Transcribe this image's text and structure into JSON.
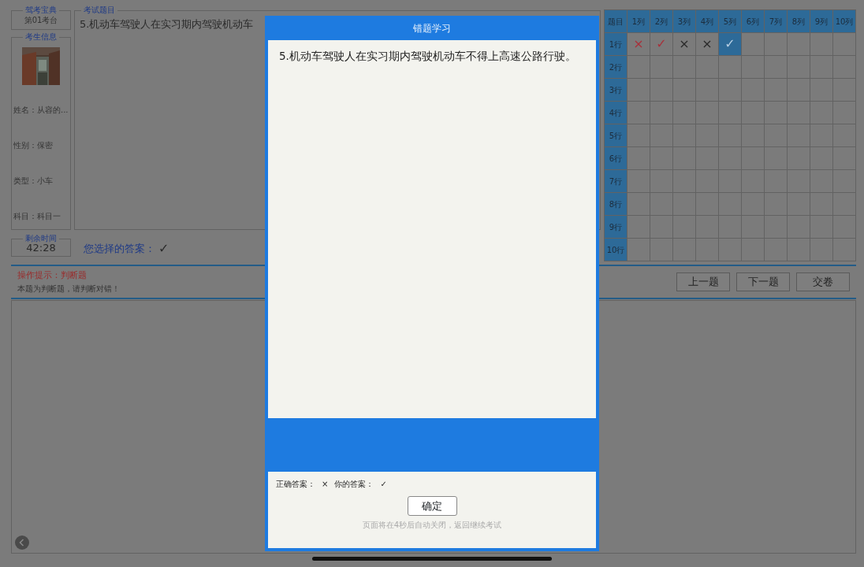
{
  "sidebar": {
    "app_box": {
      "title": "驾考宝典",
      "value": "第01考台"
    },
    "candidate": {
      "title": "考生信息",
      "photo": {
        "kind": "picture"
      },
      "fields": [
        "姓名：从容的...",
        "性别：保密",
        "类型：小车",
        "科目：科目一"
      ]
    },
    "timer": {
      "title": "剩余时间",
      "value": "42:28"
    }
  },
  "question": {
    "title": "考试题目",
    "text": "5.机动车驾驶人在实习期内驾驶机动车"
  },
  "selected_answer": {
    "label": "您选择的答案：",
    "mark": "✓"
  },
  "answer_grid": {
    "corner": "题目",
    "columns": [
      "1列",
      "2列",
      "3列",
      "4列",
      "5列",
      "6列",
      "7列",
      "8列",
      "9列",
      "10列"
    ],
    "rows": [
      "1行",
      "2行",
      "3行",
      "4行",
      "5行",
      "6行",
      "7行",
      "8行",
      "9行",
      "10行"
    ],
    "cells": [
      {
        "mark": "×",
        "wrong": true,
        "selected": false
      },
      {
        "mark": "✓",
        "wrong": true,
        "selected": false
      },
      {
        "mark": "×",
        "wrong": false,
        "selected": false
      },
      {
        "mark": "×",
        "wrong": false,
        "selected": false
      },
      {
        "mark": "✓",
        "wrong": false,
        "selected": true
      }
    ]
  },
  "hint": {
    "title": "操作提示：判断题",
    "text": "本题为判断题，请判断对错！"
  },
  "nav_buttons": [
    "上一题",
    "下一题",
    "交卷"
  ],
  "modal": {
    "title": "错题学习",
    "question": "5.机动车驾驶人在实习期内驾驶机动车不得上高速公路行驶。",
    "correct_label": "正确答案：",
    "correct_mark": "×",
    "your_label": "你的答案：",
    "your_mark": "✓",
    "confirm": "确定",
    "note": "页面将在4秒后自动关闭，返回继续考试"
  }
}
